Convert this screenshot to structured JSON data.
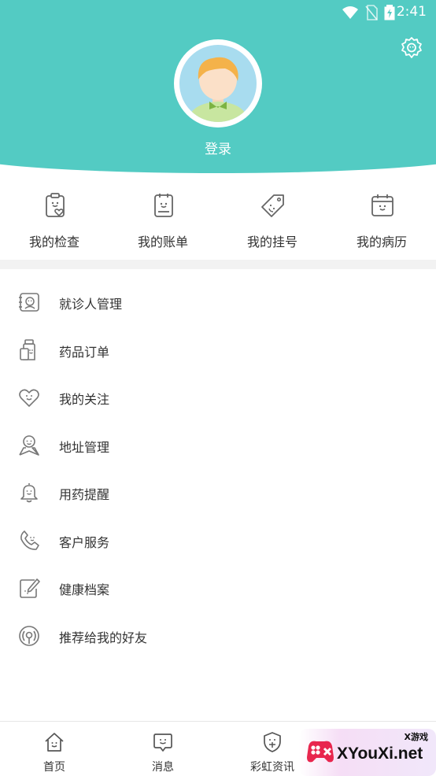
{
  "status_bar": {
    "time": "2:41"
  },
  "profile": {
    "login_label": "登录"
  },
  "quick_actions": [
    {
      "label": "我的检查",
      "icon": "clipboard-heart-icon"
    },
    {
      "label": "我的账单",
      "icon": "bill-icon"
    },
    {
      "label": "我的挂号",
      "icon": "tag-icon"
    },
    {
      "label": "我的病历",
      "icon": "calendar-record-icon"
    }
  ],
  "menu": [
    {
      "label": "就诊人管理",
      "icon": "patient-card-icon"
    },
    {
      "label": "药品订单",
      "icon": "medicine-bottle-icon"
    },
    {
      "label": "我的关注",
      "icon": "heart-icon"
    },
    {
      "label": "地址管理",
      "icon": "location-person-icon"
    },
    {
      "label": "用药提醒",
      "icon": "bell-icon"
    },
    {
      "label": "客户服务",
      "icon": "phone-icon"
    },
    {
      "label": "健康档案",
      "icon": "edit-document-icon"
    },
    {
      "label": "推荐给我的好友",
      "icon": "share-signal-icon"
    }
  ],
  "tabbar": [
    {
      "label": "首页",
      "icon": "home-icon"
    },
    {
      "label": "消息",
      "icon": "message-icon"
    },
    {
      "label": "彩虹资讯",
      "icon": "shield-news-icon"
    }
  ],
  "watermark": {
    "small": "X游戏",
    "text": "XYouXi.net"
  },
  "colors": {
    "primary": "#53CBC3",
    "icon_gray": "#7a7a7a",
    "text": "#333333",
    "divider": "#f2f2f2"
  }
}
